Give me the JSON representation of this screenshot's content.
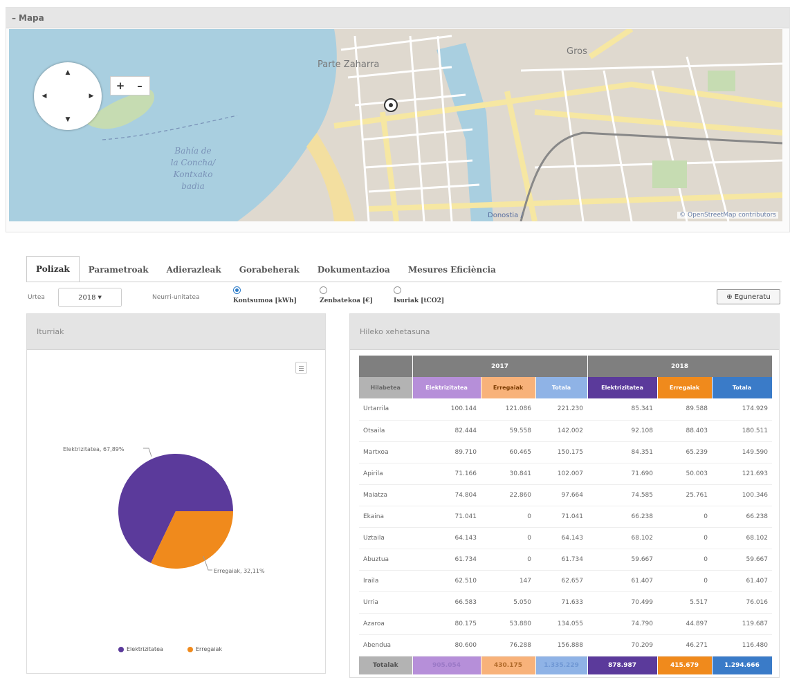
{
  "map": {
    "title": "Mapa",
    "collapse_icon": "minus-icon",
    "zoom_in": "+",
    "zoom_out": "–",
    "labels": {
      "parte_zaharra": "Parte Zaharra",
      "gros": "Gros",
      "bay": [
        "Bahía de",
        "la Concha/",
        "Kontxako",
        "badia"
      ],
      "donostia": "Donostia /"
    },
    "attribution": "© OpenStreetMap contributors"
  },
  "tabs": [
    {
      "label": "Polizak",
      "active": true
    },
    {
      "label": "Parametroak",
      "active": false
    },
    {
      "label": "Adierazleak",
      "active": false
    },
    {
      "label": "Gorabeherak",
      "active": false
    },
    {
      "label": "Dokumentazioa",
      "active": false
    },
    {
      "label": "Mesures Eficiència",
      "active": false
    }
  ],
  "filters": {
    "year_label": "Urtea",
    "year_value": "2018",
    "unit_label": "Neurri-unitatea",
    "options": [
      {
        "label": "Kontsumoa [kWh]",
        "checked": true
      },
      {
        "label": "Zenbatekoa [€]",
        "checked": false
      },
      {
        "label": "Isuriak [tCO2]",
        "checked": false
      }
    ],
    "update_button": "Eguneratu"
  },
  "sources_panel": {
    "title": "Iturriak",
    "slice_labels": [
      "Elektrizitatea, 67,89%",
      "Erregaiak, 32,11%"
    ],
    "legend": [
      "Elektrizitatea",
      "Erregaiak"
    ]
  },
  "monthly_panel": {
    "title": "Hileko xehetasuna",
    "years": [
      "2017",
      "2018"
    ],
    "headers": [
      "Hilabetea",
      "Elektrizitatea",
      "Erregaiak",
      "Totala",
      "Elektrizitatea",
      "Erregaiak",
      "Totala"
    ],
    "rows": [
      [
        "Urtarrila",
        "100.144",
        "121.086",
        "221.230",
        "85.341",
        "89.588",
        "174.929"
      ],
      [
        "Otsaila",
        "82.444",
        "59.558",
        "142.002",
        "92.108",
        "88.403",
        "180.511"
      ],
      [
        "Martxoa",
        "89.710",
        "60.465",
        "150.175",
        "84.351",
        "65.239",
        "149.590"
      ],
      [
        "Apirila",
        "71.166",
        "30.841",
        "102.007",
        "71.690",
        "50.003",
        "121.693"
      ],
      [
        "Maiatza",
        "74.804",
        "22.860",
        "97.664",
        "74.585",
        "25.761",
        "100.346"
      ],
      [
        "Ekaina",
        "71.041",
        "0",
        "71.041",
        "66.238",
        "0",
        "66.238"
      ],
      [
        "Uztaila",
        "64.143",
        "0",
        "64.143",
        "68.102",
        "0",
        "68.102"
      ],
      [
        "Abuztua",
        "61.734",
        "0",
        "61.734",
        "59.667",
        "0",
        "59.667"
      ],
      [
        "Iraila",
        "62.510",
        "147",
        "62.657",
        "61.407",
        "0",
        "61.407"
      ],
      [
        "Urria",
        "66.583",
        "5.050",
        "71.633",
        "70.499",
        "5.517",
        "76.016"
      ],
      [
        "Azaroa",
        "80.175",
        "53.880",
        "134.055",
        "74.790",
        "44.897",
        "119.687"
      ],
      [
        "Abendua",
        "80.600",
        "76.288",
        "156.888",
        "70.209",
        "46.271",
        "116.480"
      ]
    ],
    "totals": [
      "Totalak",
      "905.054",
      "430.175",
      "1.335.229",
      "878.987",
      "415.679",
      "1.294.666"
    ]
  },
  "colors": {
    "electricity": "#5b3a9b",
    "fuel": "#f08a1c",
    "total": "#3a7bc8",
    "electricity_light": "#b68fd9",
    "fuel_light": "#f8b27a",
    "total_light": "#8fb3e6"
  },
  "chart_data": {
    "type": "pie",
    "categories": [
      "Elektrizitatea",
      "Erregaiak"
    ],
    "values": [
      67.89,
      32.11
    ],
    "legend": "bottom"
  }
}
